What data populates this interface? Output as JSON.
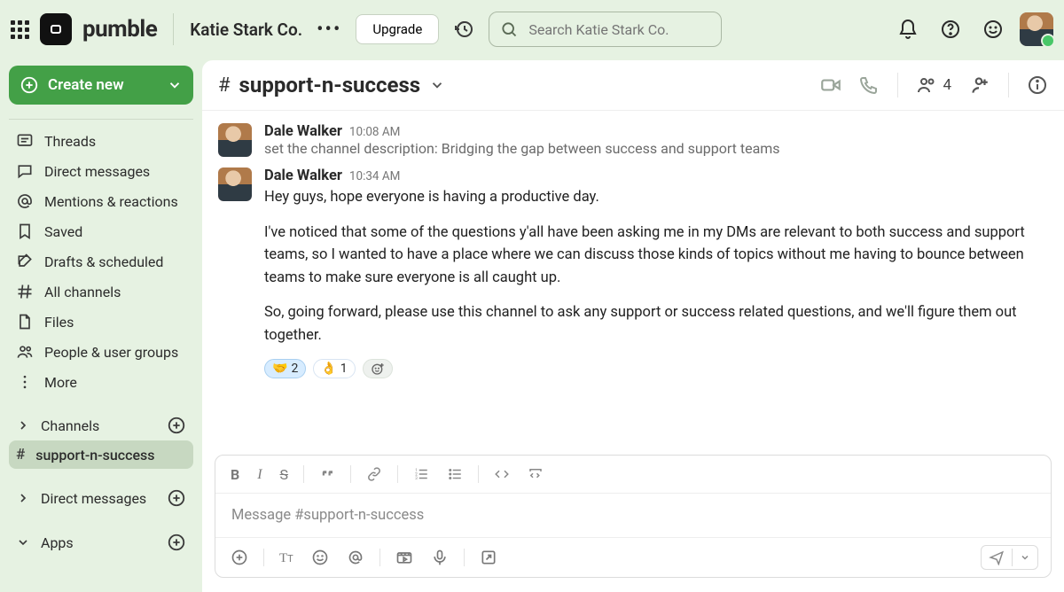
{
  "brand": {
    "name": "pumble"
  },
  "workspace": {
    "name": "Katie Stark Co."
  },
  "topbar": {
    "upgrade": "Upgrade",
    "search_placeholder": "Search Katie Stark Co."
  },
  "sidebar": {
    "create_label": "Create new",
    "nav": [
      {
        "icon": "threads",
        "label": "Threads"
      },
      {
        "icon": "dm",
        "label": "Direct messages"
      },
      {
        "icon": "mentions",
        "label": "Mentions & reactions"
      },
      {
        "icon": "saved",
        "label": "Saved"
      },
      {
        "icon": "drafts",
        "label": "Drafts & scheduled"
      },
      {
        "icon": "allch",
        "label": "All channels"
      },
      {
        "icon": "files",
        "label": "Files"
      },
      {
        "icon": "people",
        "label": "People & user groups"
      },
      {
        "icon": "more",
        "label": "More"
      }
    ],
    "sections": {
      "channels": {
        "label": "Channels",
        "items": [
          {
            "name": "support-n-success",
            "selected": true
          }
        ]
      },
      "dms": {
        "label": "Direct messages"
      },
      "apps": {
        "label": "Apps"
      }
    }
  },
  "channel": {
    "name": "support-n-success",
    "member_count": "4"
  },
  "messages": [
    {
      "author": "Dale Walker",
      "time": "10:08 AM",
      "system": "set the channel description: Bridging the gap between success and support teams"
    },
    {
      "author": "Dale Walker",
      "time": "10:34 AM",
      "paragraphs": [
        "Hey guys, hope everyone is having a productive day.",
        "I've noticed that some of the questions y'all have been asking me in my DMs are relevant to both success and support teams, so I wanted to have a place where we can discuss those kinds of topics without me having to bounce between teams to make sure everyone is all caught up.",
        "So, going forward, please use this channel to ask any support or success related questions, and we'll figure them out together."
      ],
      "reactions": [
        {
          "emoji": "🤝",
          "count": "2",
          "mine": true
        },
        {
          "emoji": "👌",
          "count": "1",
          "mine": false
        }
      ]
    }
  ],
  "composer": {
    "placeholder": "Message #support-n-success"
  }
}
